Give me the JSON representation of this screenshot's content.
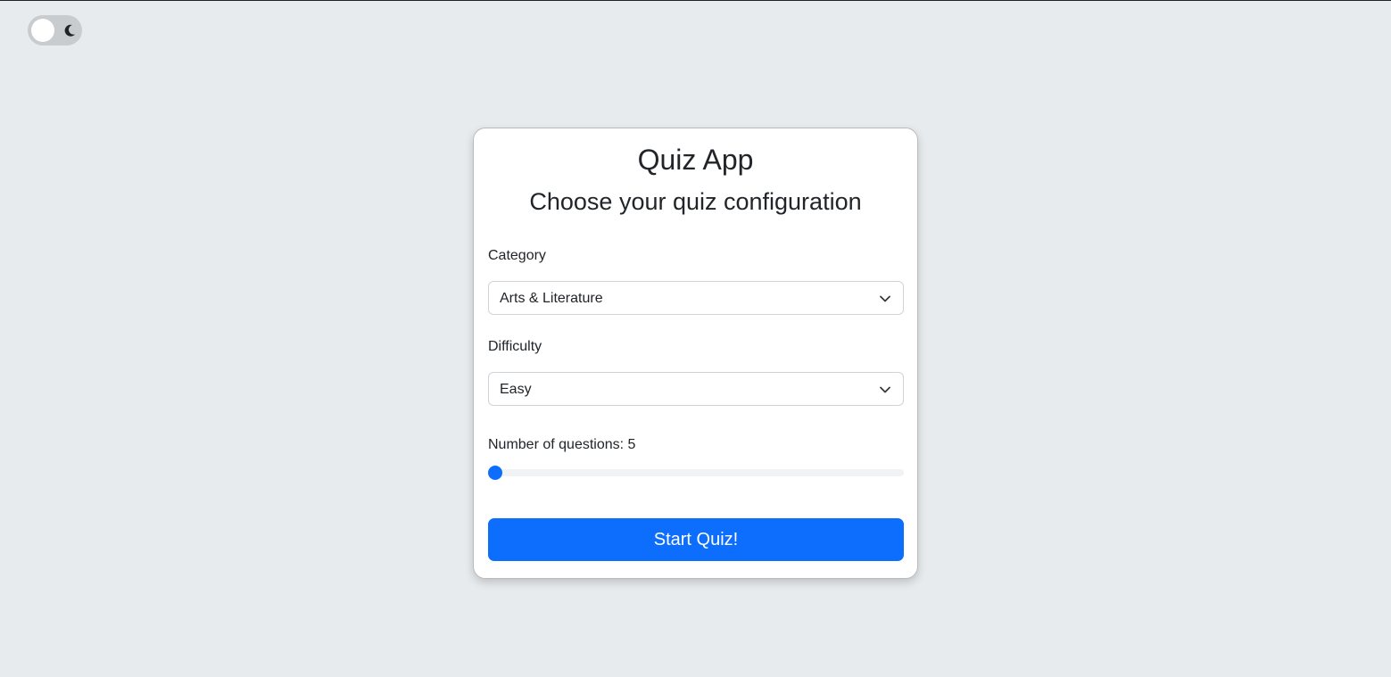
{
  "theme_toggle": {
    "icon": "moon-icon",
    "state": "off"
  },
  "card": {
    "app_title": "Quiz App",
    "config_title": "Choose your quiz configuration",
    "category": {
      "label": "Category",
      "selected": "Arts & Literature"
    },
    "difficulty": {
      "label": "Difficulty",
      "selected": "Easy"
    },
    "questions": {
      "label": "Number of questions: ",
      "value": "5",
      "slider_fraction": 0.0
    },
    "start_button": "Start Quiz!"
  },
  "colors": {
    "accent": "#0d6efd",
    "background": "#e8ebee"
  }
}
